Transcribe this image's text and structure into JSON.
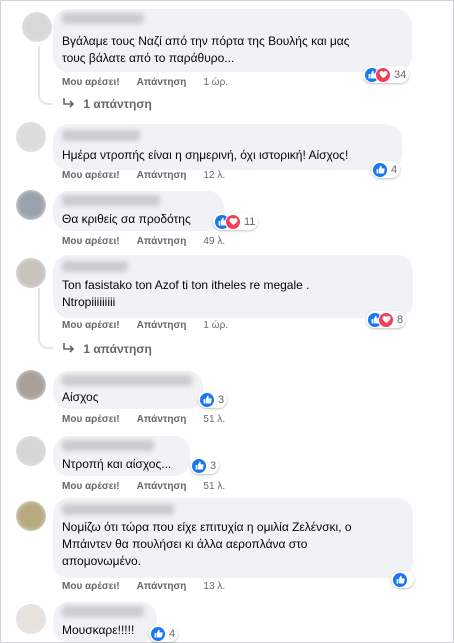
{
  "actions": {
    "like": "Μου αρέσει!",
    "reply": "Απάντηση"
  },
  "colors": {
    "like": "#1877f2",
    "love": "#f33e58",
    "bubble": "#f0f2f5",
    "meta_text": "#65676b"
  },
  "comments": [
    {
      "author": "",
      "lines": [
        "Βγάλαμε τους Ναζί από την πόρτα της Βουλής και μας",
        "τους βάλατε από το παράθυρο..."
      ],
      "time": "1 ώρ.",
      "reactions": [
        "like",
        "love"
      ],
      "reaction_count": "34",
      "replies": "1 απάντηση"
    },
    {
      "author": "",
      "lines": [
        "Ημέρα ντροπής είναι η σημερινή, όχι ιστορική! Αίσχος!"
      ],
      "time": "12 λ.",
      "reactions": [
        "like"
      ],
      "reaction_count": "4",
      "replies": ""
    },
    {
      "author": "",
      "lines": [
        "Θα κριθείς σα προδότης"
      ],
      "time": "49 λ.",
      "reactions": [
        "like",
        "love"
      ],
      "reaction_count": "11",
      "replies": ""
    },
    {
      "author": "",
      "lines": [
        "Ton fasistako ton Azof ti ton itheles re megale .",
        "Ntropiiiiiiiii"
      ],
      "time": "1 ώρ.",
      "reactions": [
        "like",
        "love"
      ],
      "reaction_count": "8",
      "replies": "1 απάντηση"
    },
    {
      "author": "",
      "lines": [
        "Αίσχος"
      ],
      "time": "51 λ.",
      "reactions": [
        "like"
      ],
      "reaction_count": "3",
      "replies": ""
    },
    {
      "author": "",
      "lines": [
        "Ντροπή και αίσχος..."
      ],
      "time": "51 λ.",
      "reactions": [
        "like"
      ],
      "reaction_count": "3",
      "replies": ""
    },
    {
      "author": "",
      "lines": [
        "Νομίζω ότι τώρα που είχε επιτυχία η ομιλία Ζελένσκι, ο",
        "Μπάιντεν θα πουλήσει κι άλλα αεροπλάνα στο",
        "απομονωμένο."
      ],
      "time": "13 λ.",
      "reactions": [
        "like"
      ],
      "reaction_count": "",
      "replies": ""
    },
    {
      "author": "",
      "lines": [
        "Μουσκαρε!!!!!"
      ],
      "time": "",
      "reactions": [
        "like"
      ],
      "reaction_count": "4",
      "replies": ""
    }
  ]
}
